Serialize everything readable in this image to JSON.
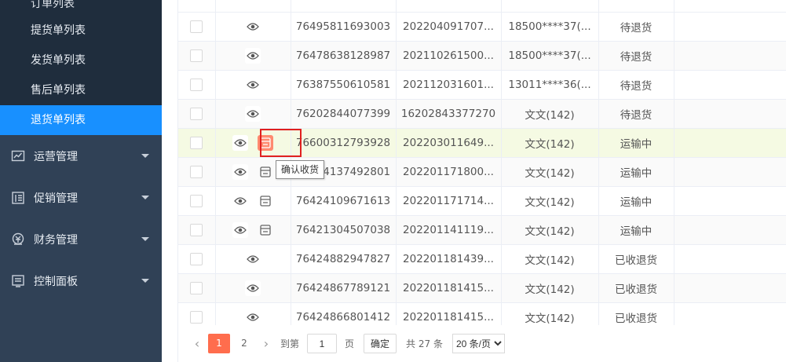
{
  "sidebar": {
    "sub_items": [
      "订单列表",
      "提货单列表",
      "发货单列表",
      "售后单列表",
      "退货单列表"
    ],
    "active_sub": "退货单列表",
    "menus": [
      {
        "label": "运营管理",
        "icon": "trend-chart-icon"
      },
      {
        "label": "促销管理",
        "icon": "promotion-icon"
      },
      {
        "label": "财务管理",
        "icon": "finance-icon"
      },
      {
        "label": "控制面板",
        "icon": "dashboard-icon"
      }
    ]
  },
  "table": {
    "rows": [
      {
        "order_no": "76495811693003",
        "code": "202204091707...",
        "user": "18500****37(...",
        "status": "待退货",
        "actions": [
          "view"
        ]
      },
      {
        "order_no": "76478638128987",
        "code": "202110261500...",
        "user": "18500****37(...",
        "status": "待退货",
        "actions": [
          "view"
        ]
      },
      {
        "order_no": "76387550610581",
        "code": "202112031601...",
        "user": "13011****36(...",
        "status": "待退货",
        "actions": [
          "view"
        ]
      },
      {
        "order_no": "76202844077399",
        "code": "16202843377270",
        "user": "文文(142)",
        "status": "待退货",
        "actions": [
          "view"
        ]
      },
      {
        "order_no": "76600312793928",
        "code": "202203011649...",
        "user": "文文(142)",
        "status": "运输中",
        "actions": [
          "view",
          "receive"
        ]
      },
      {
        "order_no": "76424137492801",
        "code": "202201171800...",
        "user": "文文(142)",
        "status": "运输中",
        "actions": [
          "view",
          "receive"
        ]
      },
      {
        "order_no": "76424109671613",
        "code": "202201171714...",
        "user": "文文(142)",
        "status": "运输中",
        "actions": [
          "view",
          "receive"
        ]
      },
      {
        "order_no": "76421304507038",
        "code": "202201141119...",
        "user": "文文(142)",
        "status": "运输中",
        "actions": [
          "view",
          "receive"
        ]
      },
      {
        "order_no": "76424882947827",
        "code": "202201181439...",
        "user": "文文(142)",
        "status": "已收退货",
        "actions": [
          "view"
        ]
      },
      {
        "order_no": "76424867789121",
        "code": "202201181415...",
        "user": "文文(142)",
        "status": "已收退货",
        "actions": [
          "view"
        ]
      },
      {
        "order_no": "76424866801412",
        "code": "202201181415...",
        "user": "文文(142)",
        "status": "已收退货",
        "actions": [
          "view"
        ]
      }
    ],
    "tooltip": "确认收货"
  },
  "pagination": {
    "pages": [
      "1",
      "2"
    ],
    "current": "1",
    "goto_label": "到第",
    "goto_value": "1",
    "page_unit": "页",
    "confirm_label": "确定",
    "total": "共 27 条",
    "page_size": "20 条/页"
  },
  "colors": {
    "sidebar": "#304156",
    "active": "#1890ff",
    "accent": "#ff6d4d",
    "highlight_row": "#f5fae3"
  }
}
